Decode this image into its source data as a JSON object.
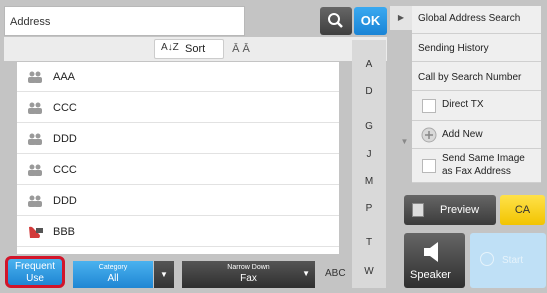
{
  "address": {
    "label": "Address",
    "value": "",
    "placeholder": ""
  },
  "buttons": {
    "ok": "OK"
  },
  "sort": {
    "az_icon": "A↓Z",
    "label": "Sort",
    "swap_icon": "Ā Ā"
  },
  "entries": [
    {
      "name": "AAA",
      "type": "group-icon"
    },
    {
      "name": "CCC",
      "type": "group-icon"
    },
    {
      "name": "DDD",
      "type": "group-icon"
    },
    {
      "name": "CCC",
      "type": "group-icon"
    },
    {
      "name": "DDD",
      "type": "group-icon"
    },
    {
      "name": "BBB",
      "type": "fax-icon"
    }
  ],
  "index_letters": [
    "A",
    "D",
    "G",
    "J",
    "M",
    "P",
    "T",
    "W"
  ],
  "bottom": {
    "frequent_use_line1": "Frequent",
    "frequent_use_line2": "Use",
    "category_caption": "Category",
    "category_value": "All",
    "narrow_caption": "Narrow Down",
    "narrow_value": "Fax",
    "abc": "ABC"
  },
  "right_panel": {
    "items": [
      "Global Address Search",
      "Sending History",
      "Call by Search Number",
      "Direct TX",
      "Add New",
      "Send Same Image",
      "as Fax Address"
    ],
    "preview": "Preview",
    "ca": "CA",
    "speaker": "Speaker",
    "start": "Start"
  },
  "colors": {
    "accent_blue": "#1f86d3",
    "highlight_red": "#d2152a",
    "ca_yellow": "#f2c400"
  }
}
